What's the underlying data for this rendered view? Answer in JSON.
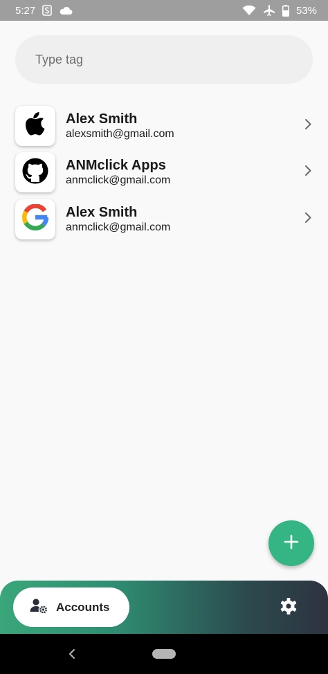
{
  "status_bar": {
    "time": "5:27",
    "battery": "53%",
    "icons": [
      "sim-s-icon",
      "cloud-icon",
      "wifi-icon",
      "airplane-icon",
      "battery-icon"
    ]
  },
  "search": {
    "placeholder": "Type tag",
    "value": ""
  },
  "accounts": [
    {
      "name": "Alex Smith",
      "email": "alexsmith@gmail.com",
      "icon": "apple-icon"
    },
    {
      "name": "ANMclick Apps",
      "email": "anmclick@gmail.com",
      "icon": "github-icon"
    },
    {
      "name": "Alex Smith",
      "email": "anmclick@gmail.com",
      "icon": "google-icon"
    }
  ],
  "fab": {
    "icon": "plus-icon",
    "color": "#35b583"
  },
  "bottom_nav": {
    "accounts_label": "Accounts",
    "accounts_icon": "user-gear-icon",
    "settings_icon": "gear-icon"
  },
  "colors": {
    "accent": "#35b583",
    "nav_gradient_start": "#3aa67a",
    "nav_gradient_end": "#2d3340"
  }
}
